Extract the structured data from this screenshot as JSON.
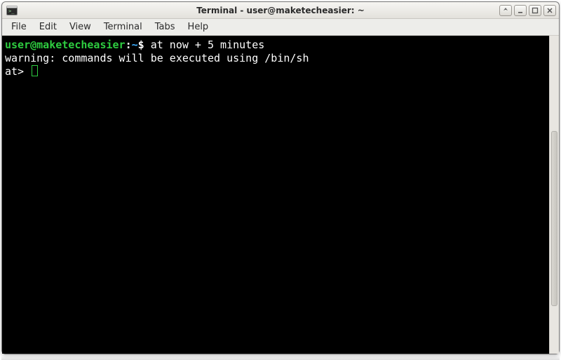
{
  "window": {
    "title": "Terminal - user@maketecheasier: ~"
  },
  "menubar": {
    "items": [
      "File",
      "Edit",
      "View",
      "Terminal",
      "Tabs",
      "Help"
    ]
  },
  "terminal": {
    "prompt": {
      "user": "user",
      "at": "@",
      "host": "maketecheasier",
      "sep": ":",
      "cwd": "~",
      "dollar": "$"
    },
    "command": " at now + 5 minutes",
    "output_line": "warning: commands will be executed using /bin/sh",
    "at_prompt": "at> "
  },
  "colors": {
    "prompt_green": "#2ecc40",
    "cwd_blue": "#3daeff",
    "bg_black": "#000000",
    "text_white": "#ffffff"
  }
}
